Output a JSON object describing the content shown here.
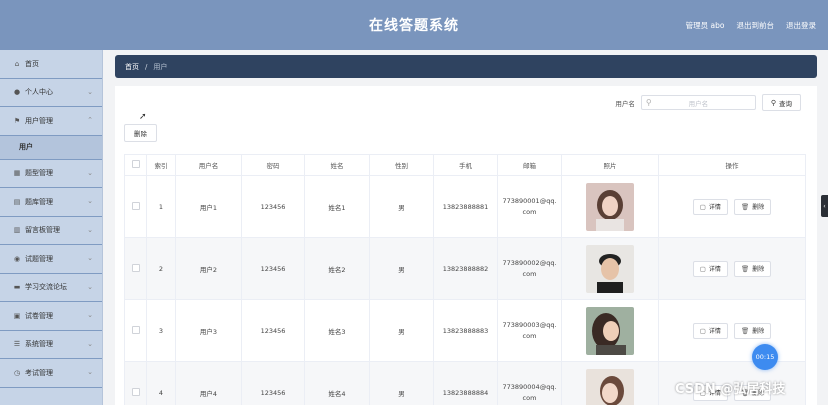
{
  "header": {
    "title": "在线答题系统",
    "admin": "管理员 abo",
    "exit_console": "退出到前台",
    "logout": "退出登录"
  },
  "sidebar": {
    "items": [
      {
        "label": "首页",
        "icon": "home-icon",
        "has_chevron": false
      },
      {
        "label": "个人中心",
        "icon": "user-icon",
        "has_chevron": true
      },
      {
        "label": "用户管理",
        "icon": "flag-icon",
        "has_chevron": true,
        "expanded": true
      },
      {
        "label": "题型管理",
        "icon": "grid-icon",
        "has_chevron": true
      },
      {
        "label": "题库管理",
        "icon": "list-icon",
        "has_chevron": true
      },
      {
        "label": "留言板管理",
        "icon": "bar-chart-icon",
        "has_chevron": true
      },
      {
        "label": "试题管理",
        "icon": "pin-icon",
        "has_chevron": true
      },
      {
        "label": "学习交流论坛",
        "icon": "chat-icon",
        "has_chevron": true
      },
      {
        "label": "试卷管理",
        "icon": "stack-icon",
        "has_chevron": true
      },
      {
        "label": "系统管理",
        "icon": "menu-icon",
        "has_chevron": true
      },
      {
        "label": "考试管理",
        "icon": "clock-icon",
        "has_chevron": true
      }
    ],
    "sub_item": "用户"
  },
  "breadcrumb": {
    "home": "首页",
    "separator": "/",
    "current": "用户"
  },
  "search": {
    "label": "用户名",
    "placeholder": "用户名",
    "button": "查询"
  },
  "toolbar": {
    "delete_label": "删除"
  },
  "table": {
    "columns": [
      "",
      "索引",
      "用户名",
      "密码",
      "姓名",
      "性别",
      "手机",
      "邮箱",
      "照片",
      "操作"
    ],
    "rows": [
      {
        "index": "1",
        "username": "用户1",
        "password": "123456",
        "name": "姓名1",
        "gender": "男",
        "phone": "13823888881",
        "email_line1": "773890001@qq.",
        "email_line2": "com"
      },
      {
        "index": "2",
        "username": "用户2",
        "password": "123456",
        "name": "姓名2",
        "gender": "男",
        "phone": "13823888882",
        "email_line1": "773890002@qq.",
        "email_line2": "com"
      },
      {
        "index": "3",
        "username": "用户3",
        "password": "123456",
        "name": "姓名3",
        "gender": "男",
        "phone": "13823888883",
        "email_line1": "773890003@qq.",
        "email_line2": "com"
      },
      {
        "index": "4",
        "username": "用户4",
        "password": "123456",
        "name": "姓名4",
        "gender": "男",
        "phone": "13823888884",
        "email_line1": "773890004@qq.",
        "email_line2": "com"
      }
    ],
    "detail_label": "详情",
    "delete_label": "删除"
  },
  "timer": "00:15",
  "watermark": "CSDN @弘居科技",
  "colors": {
    "topbar": "#7a95bd",
    "sidebar": "#c6d4e7",
    "breadcrumb": "#2f4360",
    "timer": "#3d8bf0"
  }
}
